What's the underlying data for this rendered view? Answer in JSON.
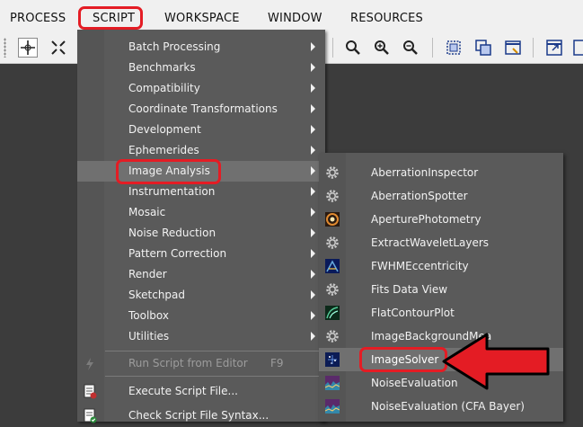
{
  "menubar": [
    "PROCESS",
    "SCRIPT",
    "WORKSPACE",
    "WINDOW",
    "RESOURCES"
  ],
  "script_menu": {
    "items": [
      {
        "label": "Batch Processing",
        "submenu": true
      },
      {
        "label": "Benchmarks",
        "submenu": true
      },
      {
        "label": "Compatibility",
        "submenu": true
      },
      {
        "label": "Coordinate Transformations",
        "submenu": true
      },
      {
        "label": "Development",
        "submenu": true
      },
      {
        "label": "Ephemerides",
        "submenu": true
      },
      {
        "label": "Image Analysis",
        "submenu": true,
        "active": true
      },
      {
        "label": "Instrumentation",
        "submenu": true
      },
      {
        "label": "Mosaic",
        "submenu": true
      },
      {
        "label": "Noise Reduction",
        "submenu": true
      },
      {
        "label": "Pattern Correction",
        "submenu": true
      },
      {
        "label": "Render",
        "submenu": true
      },
      {
        "label": "Sketchpad",
        "submenu": true
      },
      {
        "label": "Toolbox",
        "submenu": true
      },
      {
        "label": "Utilities",
        "submenu": true
      }
    ],
    "run_from_editor": {
      "label": "Run Script from Editor",
      "shortcut": "F9",
      "disabled": true
    },
    "execute_file": {
      "label": "Execute Script File..."
    },
    "check_syntax": {
      "label": "Check Script File Syntax..."
    }
  },
  "image_analysis_menu": {
    "items": [
      {
        "label": "AberrationInspector",
        "icon": "gear-icon"
      },
      {
        "label": "AberrationSpotter",
        "icon": "gear-icon"
      },
      {
        "label": "AperturePhotometry",
        "icon": "aperture-icon"
      },
      {
        "label": "ExtractWaveletLayers",
        "icon": "gear-icon"
      },
      {
        "label": "FWHMEccentricity",
        "icon": "fwhm-icon"
      },
      {
        "label": "Fits Data View",
        "icon": "gear-icon"
      },
      {
        "label": "FlatContourPlot",
        "icon": "contour-icon"
      },
      {
        "label": "ImageBackgroundMea",
        "icon": "gear-icon"
      },
      {
        "label": "ImageSolver",
        "icon": "solver-icon",
        "active": true
      },
      {
        "label": "NoiseEvaluation",
        "icon": "noise-icon"
      },
      {
        "label": "NoiseEvaluation (CFA Bayer)",
        "icon": "noise-icon"
      }
    ]
  },
  "colors": {
    "highlight": "#e41c24",
    "menu_bg": "#5a5a5a",
    "active_item": "#707070"
  }
}
